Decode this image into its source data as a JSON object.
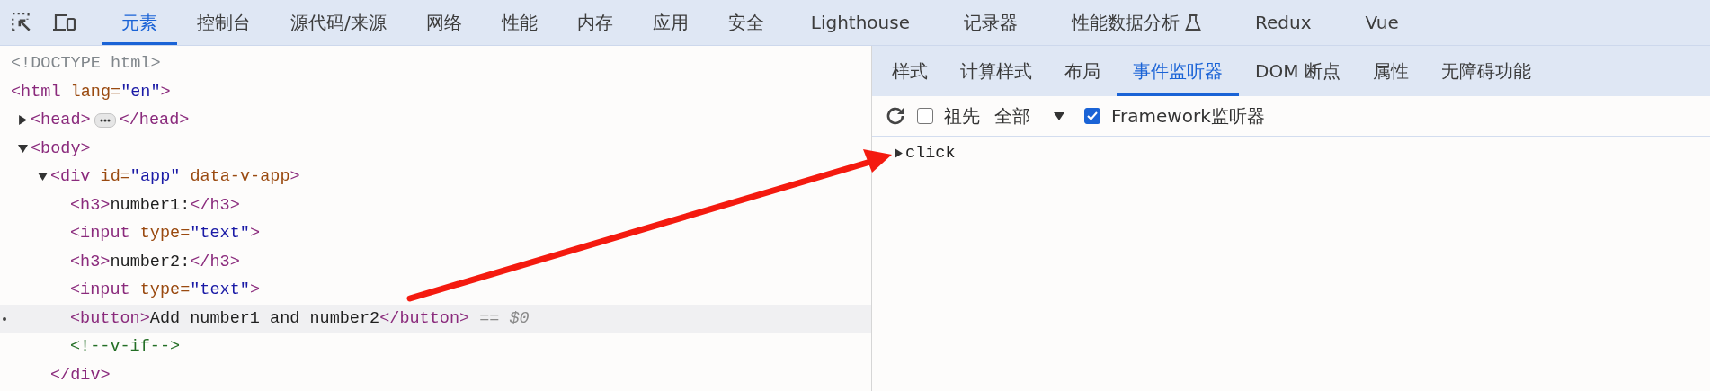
{
  "toolbar": {
    "tabs": [
      {
        "label": "元素",
        "selected": true
      },
      {
        "label": "控制台",
        "selected": false
      },
      {
        "label": "源代码/来源",
        "selected": false
      },
      {
        "label": "网络",
        "selected": false
      },
      {
        "label": "性能",
        "selected": false
      },
      {
        "label": "内存",
        "selected": false
      },
      {
        "label": "应用",
        "selected": false
      },
      {
        "label": "安全",
        "selected": false
      },
      {
        "label": "Lighthouse",
        "selected": false
      },
      {
        "label": "记录器",
        "selected": false
      },
      {
        "label": "性能数据分析",
        "selected": false,
        "experimental": true
      },
      {
        "label": "Redux",
        "selected": false
      },
      {
        "label": "Vue",
        "selected": false
      }
    ]
  },
  "dom_tree": [
    {
      "segments": [
        {
          "kind": "doctype",
          "text": "<!DOCTYPE html>"
        }
      ],
      "selected": false
    },
    {
      "segments": [
        {
          "kind": "tag",
          "text": "<html"
        },
        {
          "kind": "attr",
          "text": " lang="
        },
        {
          "kind": "value",
          "text": "\"en\""
        },
        {
          "kind": "tag",
          "text": ">"
        }
      ],
      "selected": false,
      "children": [
        {
          "segments": [
            {
              "kind": "tag",
              "text": "<head>"
            }
          ],
          "expanded": false,
          "selected": false,
          "collapsed_close": [
            {
              "kind": "tag",
              "text": "</head>"
            }
          ]
        },
        {
          "segments": [
            {
              "kind": "tag",
              "text": "<body>"
            }
          ],
          "expanded": true,
          "selected": false,
          "children": [
            {
              "segments": [
                {
                  "kind": "tag",
                  "text": "<div"
                },
                {
                  "kind": "attr",
                  "text": " id="
                },
                {
                  "kind": "value",
                  "text": "\"app\""
                },
                {
                  "kind": "attr",
                  "text": " data-v-app"
                },
                {
                  "kind": "tag",
                  "text": ">"
                }
              ],
              "expanded": true,
              "selected": false,
              "close": [
                {
                  "kind": "tag",
                  "text": "</div>"
                }
              ],
              "children": [
                {
                  "segments": [
                    {
                      "kind": "tag",
                      "text": "<h3>"
                    },
                    {
                      "kind": "text",
                      "text": "number1:"
                    },
                    {
                      "kind": "tag",
                      "text": "</h3>"
                    }
                  ],
                  "selected": false
                },
                {
                  "segments": [
                    {
                      "kind": "tag",
                      "text": "<input"
                    },
                    {
                      "kind": "attr",
                      "text": " type="
                    },
                    {
                      "kind": "value",
                      "text": "\"text\""
                    },
                    {
                      "kind": "tag",
                      "text": ">"
                    }
                  ],
                  "selected": false
                },
                {
                  "segments": [
                    {
                      "kind": "tag",
                      "text": "<h3>"
                    },
                    {
                      "kind": "text",
                      "text": "number2:"
                    },
                    {
                      "kind": "tag",
                      "text": "</h3>"
                    }
                  ],
                  "selected": false
                },
                {
                  "segments": [
                    {
                      "kind": "tag",
                      "text": "<input"
                    },
                    {
                      "kind": "attr",
                      "text": " type="
                    },
                    {
                      "kind": "value",
                      "text": "\"text\""
                    },
                    {
                      "kind": "tag",
                      "text": ">"
                    }
                  ],
                  "selected": false
                },
                {
                  "segments": [
                    {
                      "kind": "tag",
                      "text": "<button>"
                    },
                    {
                      "kind": "text",
                      "text": "Add number1 and number2"
                    },
                    {
                      "kind": "tag",
                      "text": "</button>"
                    },
                    {
                      "kind": "hint",
                      "text": " == $0"
                    }
                  ],
                  "selected": true
                },
                {
                  "segments": [
                    {
                      "kind": "comment",
                      "text": "<!--v-if-->"
                    }
                  ],
                  "selected": false
                }
              ]
            }
          ]
        }
      ]
    }
  ],
  "sidebar": {
    "tabs": [
      {
        "label": "样式",
        "selected": false
      },
      {
        "label": "计算样式",
        "selected": false
      },
      {
        "label": "布局",
        "selected": false
      },
      {
        "label": "事件监听器",
        "selected": true
      },
      {
        "label": "DOM 断点",
        "selected": false
      },
      {
        "label": "属性",
        "selected": false
      },
      {
        "label": "无障碍功能",
        "selected": false
      }
    ],
    "ancestors": {
      "label": "祖先",
      "checked": false
    },
    "filter": {
      "value": "全部"
    },
    "framework": {
      "label": "Framework监听器",
      "checked": true
    },
    "listeners": [
      {
        "name": "click",
        "expanded": false
      }
    ]
  }
}
